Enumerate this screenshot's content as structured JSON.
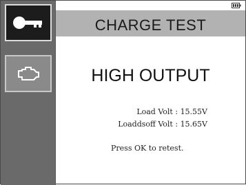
{
  "header": {
    "title": "CHARGE TEST"
  },
  "sidebar": {
    "items": [
      {
        "icon": "key-icon",
        "selected": true
      },
      {
        "icon": "engine-icon",
        "selected": false
      }
    ]
  },
  "status": {
    "battery_icon": "battery-icon",
    "result": "HIGH OUTPUT"
  },
  "readings": [
    {
      "label": "Load Volt",
      "separator": ":",
      "value": "15.55V"
    },
    {
      "label": "Loaddsoff Volt",
      "separator": ":",
      "value": "15.65V"
    }
  ],
  "footer": {
    "instruction": "Press OK to retest."
  },
  "colors": {
    "sidebar": "#6a6a6a",
    "selected_tile": "#1c1c1c",
    "title_bar": "#b2b2b2",
    "background": "#ffffff"
  }
}
